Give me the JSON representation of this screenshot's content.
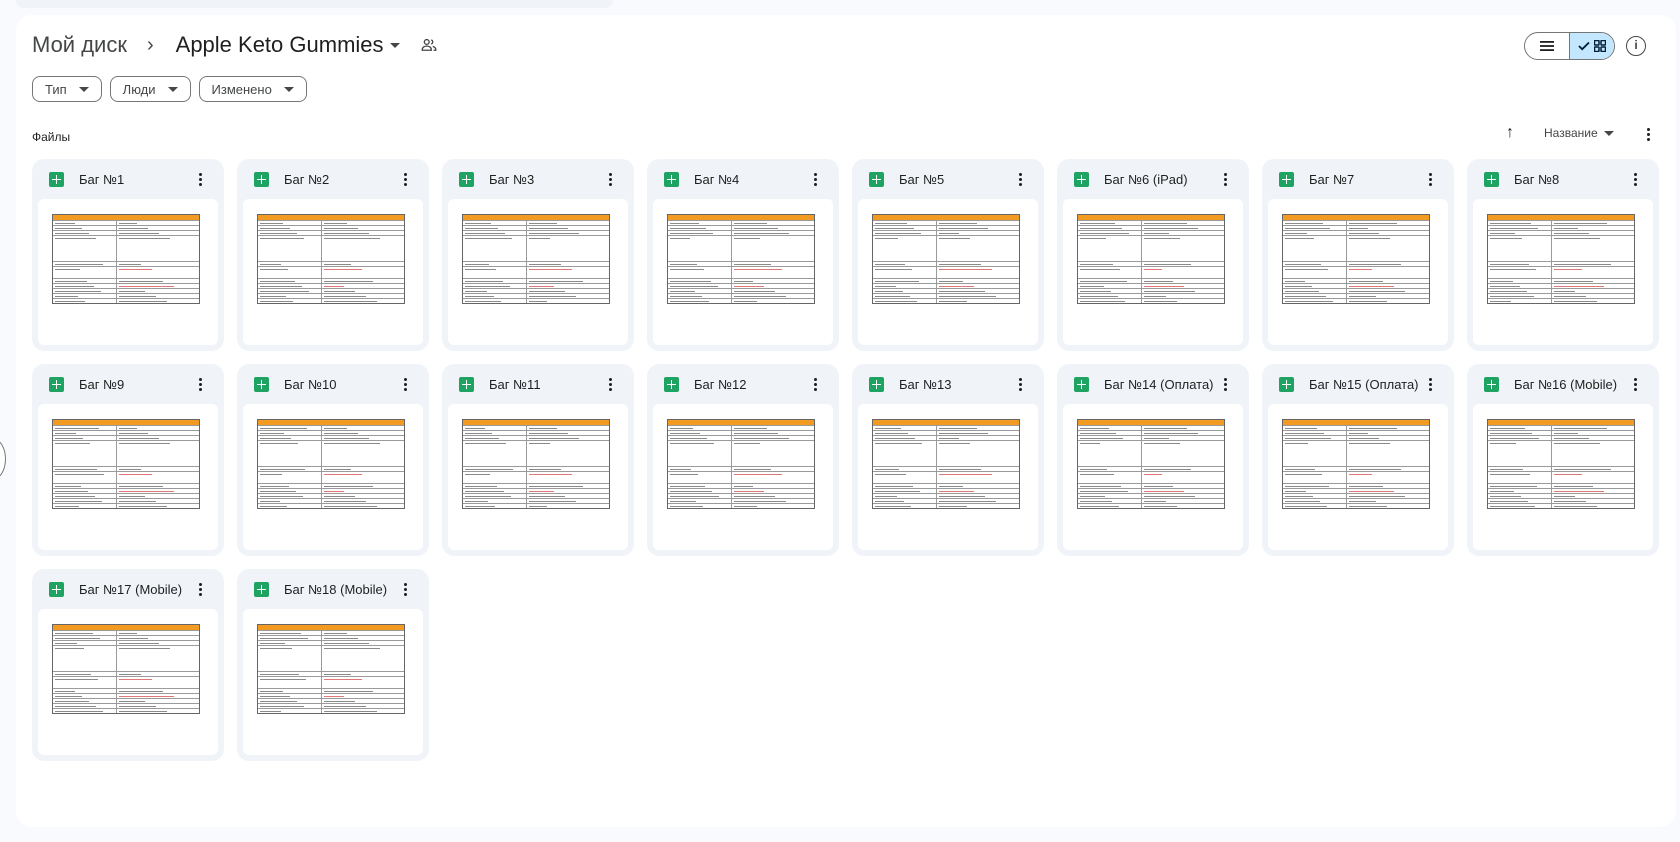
{
  "breadcrumb": {
    "root": "Мой диск",
    "separator": "›",
    "current": "Apple Keto Gummies"
  },
  "toolbar": {
    "list_view_icon": "list-icon",
    "grid_view_icon": "grid-icon",
    "info_icon": "info-icon",
    "info_glyph": "i"
  },
  "filters": [
    "Тип",
    "Люди",
    "Изменено"
  ],
  "section": {
    "label": "Файлы",
    "sort_label": "Название",
    "sort_arrow": "↑"
  },
  "files": [
    {
      "name": "Баг №1",
      "icon": "google-sheets-icon"
    },
    {
      "name": "Баг №2",
      "icon": "google-sheets-icon"
    },
    {
      "name": "Баг №3",
      "icon": "google-sheets-icon"
    },
    {
      "name": "Баг №4",
      "icon": "google-sheets-icon"
    },
    {
      "name": "Баг №5",
      "icon": "google-sheets-icon"
    },
    {
      "name": "Баг №6 (iPad)",
      "icon": "google-sheets-icon"
    },
    {
      "name": "Баг №7",
      "icon": "google-sheets-icon"
    },
    {
      "name": "Баг №8",
      "icon": "google-sheets-icon"
    },
    {
      "name": "Баг №9",
      "icon": "google-sheets-icon"
    },
    {
      "name": "Баг №10",
      "icon": "google-sheets-icon"
    },
    {
      "name": "Баг №11",
      "icon": "google-sheets-icon"
    },
    {
      "name": "Баг №12",
      "icon": "google-sheets-icon"
    },
    {
      "name": "Баг №13",
      "icon": "google-sheets-icon"
    },
    {
      "name": "Баг №14 (Оплата)",
      "icon": "google-sheets-icon"
    },
    {
      "name": "Баг №15 (Оплата)",
      "icon": "google-sheets-icon"
    },
    {
      "name": "Баг №16 (Mobile)",
      "icon": "google-sheets-icon"
    },
    {
      "name": "Баг №17 (Mobile)",
      "icon": "google-sheets-icon"
    },
    {
      "name": "Баг №18 (Mobile)",
      "icon": "google-sheets-icon"
    }
  ],
  "colors": {
    "sheets_green": "#1ea362",
    "selected_toggle": "#c2e7ff",
    "sheet_header": "#f29a21",
    "card_bg": "#f0f4f9"
  }
}
